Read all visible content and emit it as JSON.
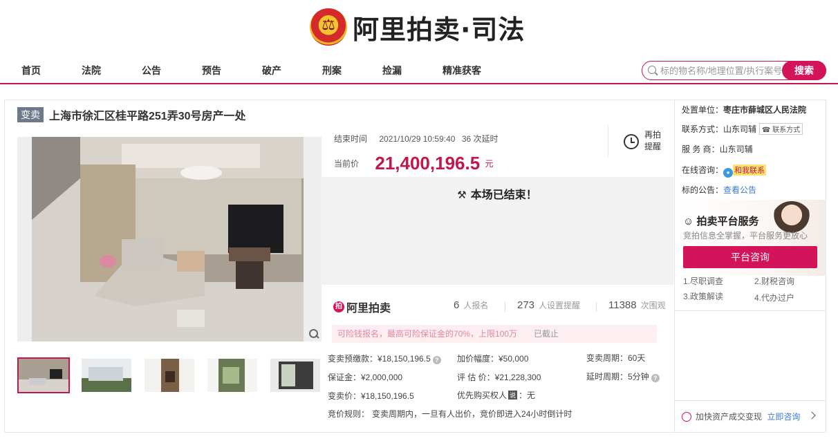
{
  "brand": {
    "name": "阿里拍卖·司法"
  },
  "nav": [
    "首页",
    "法院",
    "公告",
    "预告",
    "破产",
    "刑案",
    "捡漏",
    "精准获客"
  ],
  "search": {
    "placeholder": "标的物名称/地理位置/执行案号",
    "button": "搜索"
  },
  "item": {
    "badge": "变卖",
    "title": "上海市徐汇区桂平路251弄30号房产一处"
  },
  "auction": {
    "end_label": "结束时间",
    "end_time": "2021/10/29 10:59:40",
    "extensions": "36 次延时",
    "price_label": "当前价",
    "price": "21,400,196.5",
    "price_unit": "元",
    "remind": "再拍提醒",
    "ended_text": "本场已结束！"
  },
  "stats": {
    "logo": "阿里拍卖",
    "signups": "6",
    "signups_label": "人报名",
    "reminders": "273",
    "reminders_label": "人设置提醒",
    "views": "11388",
    "views_label": "次围观"
  },
  "notice": {
    "text": "可险钱报名，最高可险保证金的70%，上限100万",
    "status": "已截止"
  },
  "details": {
    "prepay": "变卖预缴款：¥18,150,196.5",
    "increment": "加价幅度：¥50,000",
    "period": "变卖周期：60天",
    "deposit": "保证金：¥2,000,000",
    "appraisal": "评 估 价：¥21,228,300",
    "delay": "延时周期：5分钟",
    "sale_price": "变卖价：¥18,150,196.5",
    "priority_label": "优先购买权人",
    "priority_tag": "说",
    "priority_value": "：无",
    "rules_label": "竞价规则：",
    "rules": "变卖周期内，一旦有人出价，竞价即进入24小时倒计时"
  },
  "sidebar": {
    "court_label": "处置单位：",
    "court": "枣庄市薛城区人民法院",
    "contact_label": "联系方式：",
    "contact": "山东司辅",
    "contact_tag": "联系方式",
    "provider_label": "服 务 商：",
    "provider": "山东司辅",
    "online_label": "在线咨询：",
    "online_tag": "和我联系",
    "announce_label": "标的公告：",
    "announce_link": "查看公告",
    "service_title": "拍卖平台服务",
    "service_sub": "竞拍信息全掌握，平台服务更放心",
    "consult_button": "平台咨询",
    "services": [
      "1.尽职调查",
      "2.财税咨询",
      "3.政策解读",
      "4.代办过户"
    ],
    "bottom_text": "加快资产成交变现",
    "bottom_link": "立即咨询"
  }
}
